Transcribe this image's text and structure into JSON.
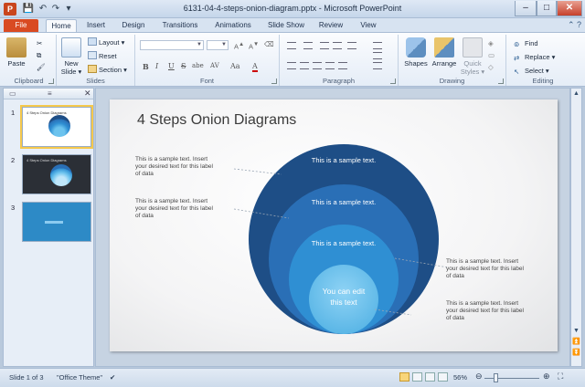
{
  "window": {
    "title": "6131-04-4-steps-onion-diagram.pptx - Microsoft PowerPoint",
    "app_icon_letter": "P",
    "qat": [
      "save-icon",
      "undo-icon",
      "redo-icon",
      "customize-icon"
    ],
    "controls": {
      "minimize": "–",
      "maximize": "□",
      "close": "✕"
    }
  },
  "tabs": {
    "file": "File",
    "items": [
      "Home",
      "Insert",
      "Design",
      "Transitions",
      "Animations",
      "Slide Show",
      "Review",
      "View"
    ],
    "active": "Home"
  },
  "ribbon": {
    "clipboard": {
      "label": "Clipboard",
      "paste": "Paste"
    },
    "slides": {
      "label": "Slides",
      "new_slide": "New Slide",
      "new_slide_l1": "New",
      "new_slide_l2": "Slide ▾",
      "layout": "Layout ▾",
      "reset": "Reset",
      "section": "Section ▾"
    },
    "font": {
      "label": "Font",
      "bold": "B",
      "italic": "I",
      "underline": "U",
      "strike": "S",
      "shadow": "abe",
      "spacing": "AV",
      "case": "Aa",
      "color": "A"
    },
    "paragraph": {
      "label": "Paragraph"
    },
    "drawing": {
      "label": "Drawing",
      "shapes": "Shapes",
      "arrange": "Arrange",
      "quick_styles_l1": "Quick",
      "quick_styles_l2": "Styles ▾"
    },
    "editing": {
      "label": "Editing",
      "find": "Find",
      "replace": "Replace ▾",
      "select": "Select ▾"
    }
  },
  "thumbnails": [
    {
      "num": "1",
      "title": "4 Steps Onion Diagrams",
      "selected": true
    },
    {
      "num": "2",
      "title": "4 Steps Onion Diagrams",
      "selected": false
    },
    {
      "num": "3",
      "title": "",
      "selected": false
    }
  ],
  "slide": {
    "title": "4 Steps Onion Diagrams",
    "rings": [
      "This is a sample text.",
      "This is a sample text.",
      "This is a sample text."
    ],
    "center": {
      "line1": "You can edit",
      "line2": "this text"
    },
    "notes_left": [
      {
        "l1": "This is a sample text. Insert",
        "l2": "your desired text for this label",
        "l3": "of data"
      },
      {
        "l1": "This is a sample text. Insert",
        "l2": "your desired text for this label",
        "l3": "of data"
      }
    ],
    "notes_right": [
      {
        "l1": "This is a sample text. Insert",
        "l2": "your desired text for this label",
        "l3": "of data"
      },
      {
        "l1": "This is a sample text. Insert",
        "l2": "your desired text for this label",
        "l3": "of data"
      }
    ],
    "colors": {
      "ring1": "#1e4e86",
      "ring2": "#2a6fb6",
      "ring3": "#2f8fd3",
      "center": "#6cc3ee"
    }
  },
  "status": {
    "slide_of": "Slide 1 of 3",
    "theme": "\"Office Theme\"",
    "zoom": "56%"
  }
}
